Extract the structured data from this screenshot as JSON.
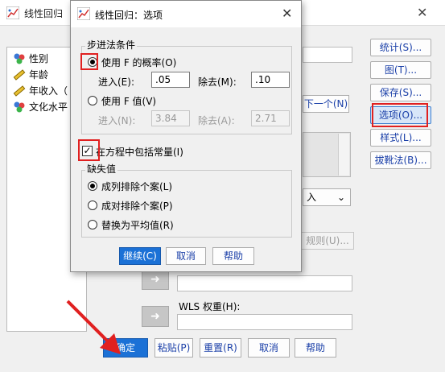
{
  "main_window": {
    "title": "线性回归",
    "close_glyph": "✕",
    "variables": [
      {
        "label": "性别",
        "icon": "nominal-variable-icon"
      },
      {
        "label": "年龄",
        "icon": "scale-variable-icon"
      },
      {
        "label": "年收入（",
        "icon": "scale-variable-icon"
      },
      {
        "label": "文化水平",
        "icon": "nominal-variable-icon"
      }
    ],
    "next_button": "下一个(N)",
    "method_suffix": "入",
    "rule_button": "规则(U)...",
    "wls_label": "WLS 权重(H):",
    "right_buttons": [
      "统计(S)...",
      "图(T)...",
      "保存(S)...",
      "选项(O)...",
      "样式(L)...",
      "拔靴法(B)..."
    ],
    "bottom_buttons": [
      "确定",
      "粘贴(P)",
      "重置(R)",
      "取消",
      "帮助"
    ]
  },
  "dialog": {
    "title": "线性回归：选项",
    "close_glyph": "✕",
    "stepwise_group": "步进法条件",
    "use_f_prob": "使用 F 的概率(O)",
    "entry_label": "进入(E):",
    "entry_value": ".05",
    "removal_label": "除去(M):",
    "removal_value": ".10",
    "use_f_value": "使用 F 值(V)",
    "entry_f_label": "进入(N):",
    "entry_f_value": "3.84",
    "removal_f_label": "除去(A):",
    "removal_f_value": "2.71",
    "include_constant": "在方程中包括常量(I)",
    "missing_group": "缺失值",
    "missing_options": [
      "成列排除个案(L)",
      "成对排除个案(P)",
      "替换为平均值(R)"
    ],
    "buttons": [
      "继续(C)",
      "取消",
      "帮助"
    ]
  },
  "colors": {
    "accent_blue": "#1b71d6",
    "link_blue": "#1a3fa8",
    "highlight_red": "#e02020"
  }
}
